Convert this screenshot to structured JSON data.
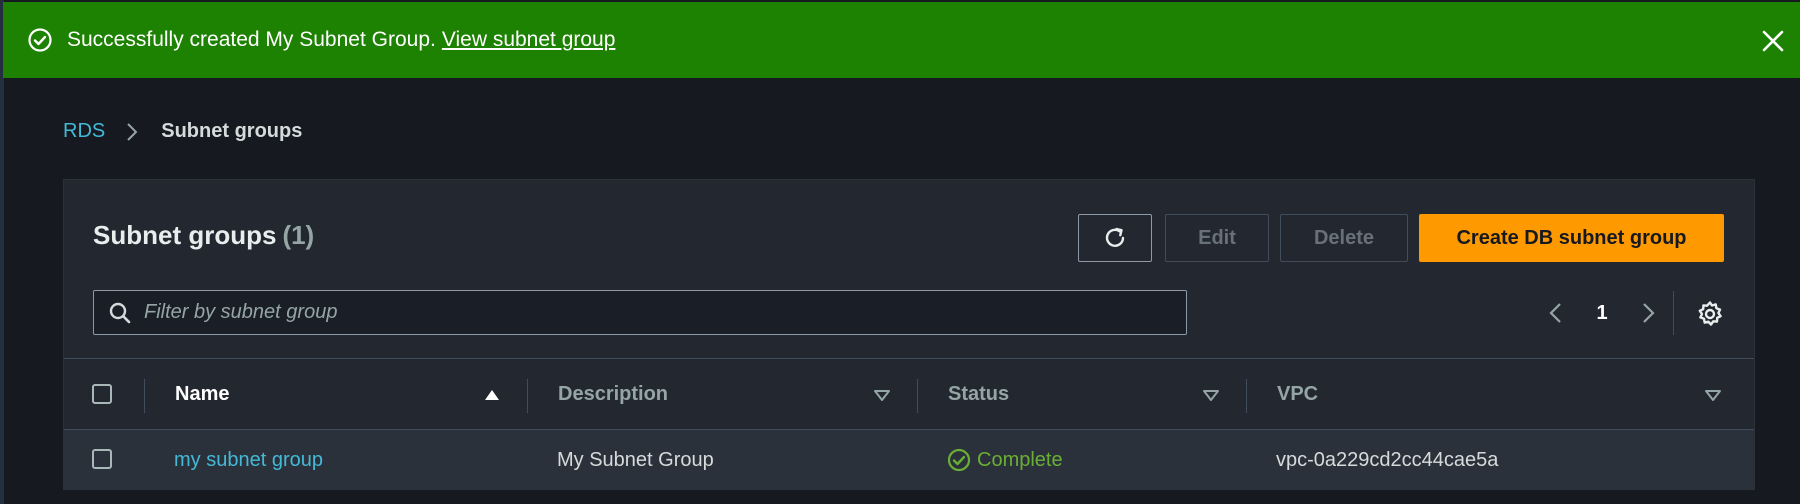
{
  "flash": {
    "message": "Successfully created My Subnet Group.",
    "link_text": "View subnet group",
    "icon": "check-circle-icon",
    "close_icon": "close-icon",
    "color": "#1d8102"
  },
  "breadcrumb": {
    "items": [
      {
        "label": "RDS"
      },
      {
        "label": "Subnet groups"
      }
    ]
  },
  "panel": {
    "title": "Subnet groups",
    "count": "(1)",
    "buttons": {
      "refresh_icon": "refresh-icon",
      "edit": "Edit",
      "delete": "Delete",
      "create": "Create DB subnet group"
    },
    "search": {
      "placeholder": "Filter by subnet group",
      "value": ""
    },
    "pagination": {
      "current_page": "1"
    },
    "accent_color": "#ff9900"
  },
  "table": {
    "columns": [
      {
        "label": "Name",
        "sort": "ascending"
      },
      {
        "label": "Description",
        "sort": "none"
      },
      {
        "label": "Status",
        "sort": "none"
      },
      {
        "label": "VPC",
        "sort": "none"
      }
    ],
    "rows": [
      {
        "name": "my subnet group",
        "description": "My Subnet Group",
        "status": "Complete",
        "vpc": "vpc-0a229cd2cc44cae5a"
      }
    ],
    "status_color": "#6aaf35",
    "link_color": "#44b9d6"
  }
}
